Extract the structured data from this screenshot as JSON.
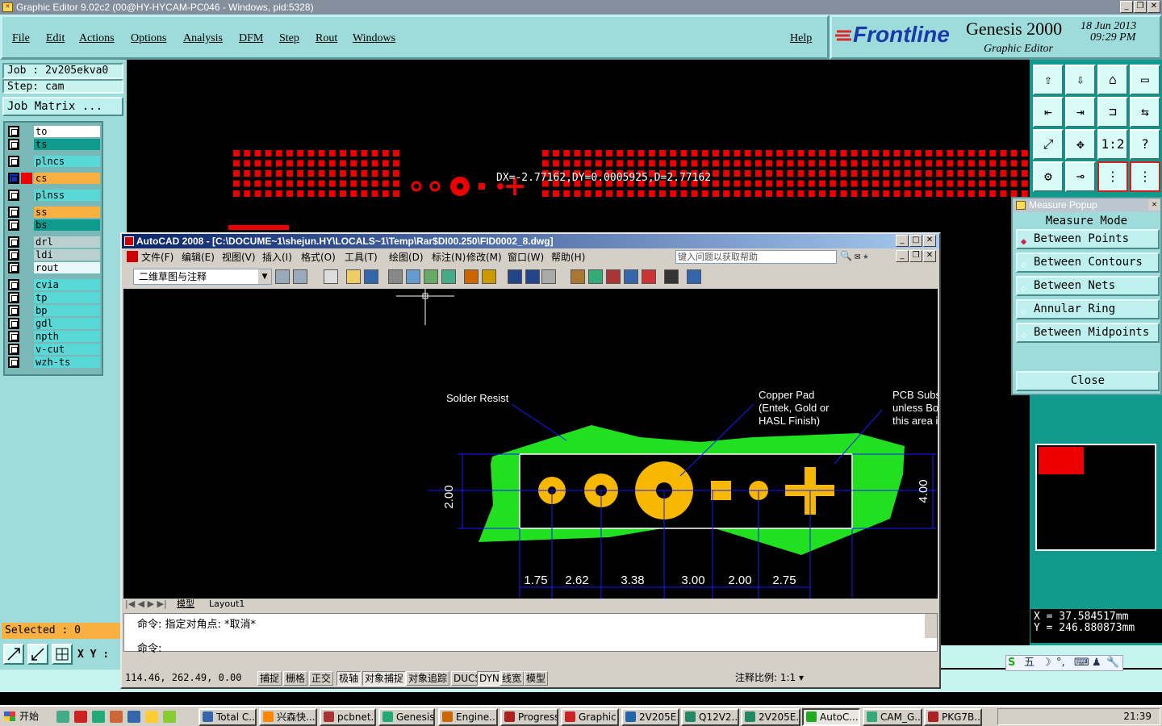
{
  "window": {
    "title": "Graphic Editor 9.02c2 (00@HY-HYCAM-PC046 - Windows, pid:5328)"
  },
  "menu": [
    "File",
    "Edit",
    "Actions",
    "Options",
    "Analysis",
    "DFM",
    "Step",
    "Rout",
    "Windows"
  ],
  "help": "Help",
  "brand": {
    "logo": "Frontline",
    "product": "Genesis 2000",
    "subtitle": "Graphic Editor",
    "date": "18 Jun 2013",
    "time": "09:29 PM"
  },
  "job": {
    "job_label": "Job : 2v205ekva0",
    "step_label": "Step: cam",
    "matrix_button": "Job Matrix ..."
  },
  "layers": [
    {
      "name": "to",
      "color": "#ffffff"
    },
    {
      "name": "ts",
      "color": "#0f9a8e"
    },
    {
      "name": "plncs",
      "color": "#59d8d8"
    },
    {
      "name": "cs",
      "color": "#f8b040",
      "active": true
    },
    {
      "name": "plnss",
      "color": "#59d8d8"
    },
    {
      "name": "ss",
      "color": "#f8b040"
    },
    {
      "name": "bs",
      "color": "#0f9a8e"
    },
    {
      "name": "drl",
      "color": "#b9d0d0"
    },
    {
      "name": "ldi",
      "color": "#b9d0d0"
    },
    {
      "name": "rout",
      "color": "#e8f8f8"
    },
    {
      "name": "cvia",
      "color": "#59d8d8"
    },
    {
      "name": "tp",
      "color": "#59d8d8"
    },
    {
      "name": "bp",
      "color": "#59d8d8"
    },
    {
      "name": "gdl",
      "color": "#59d8d8"
    },
    {
      "name": "npth",
      "color": "#59d8d8"
    },
    {
      "name": "v-cut",
      "color": "#59d8d8"
    },
    {
      "name": "wzh-ts",
      "color": "#59d8d8"
    }
  ],
  "selected": "Selected : 0",
  "xy_label": "X Y :",
  "measure_readout": "DX=-2.77162,DY=0.0005925,D=2.77162",
  "measure_popup": {
    "title": "Measure Popup",
    "mode_label": "Measure Mode",
    "options": [
      "Between Points",
      "Between Contours",
      "Between Nets",
      "Annular Ring",
      "Between Midpoints"
    ],
    "selected": "Between Points",
    "close": "Close"
  },
  "coords": {
    "x": "X  = 37.584517mm",
    "y": "Y  = 246.880873mm"
  },
  "autocad": {
    "title": "AutoCAD 2008 - [C:\\DOCUME~1\\shejun.HY\\LOCALS~1\\Temp\\Rar$DI00.250\\FID0002_8.dwg]",
    "menu": [
      "文件(F)",
      "编辑(E)",
      "视图(V)",
      "插入(I)",
      "格式(O)",
      "工具(T)",
      "绘图(D)",
      "标注(N)",
      "修改(M)",
      "窗口(W)",
      "帮助(H)"
    ],
    "help_placeholder": "键入问题以获取帮助",
    "workspace": "二维草图与注释",
    "tabs": [
      "模型",
      "Layout1"
    ],
    "annotations": {
      "solder_resist": "Solder Resist",
      "copper_pad": [
        "Copper Pad",
        "(Entek, Gold or",
        "HASL Finish)"
      ],
      "pcb_sub": [
        "PCB Subs",
        "unless Bo",
        "this area i"
      ]
    },
    "dimensions": {
      "h_left": "2.00",
      "h_right": "4.00",
      "bottom": [
        "1.75",
        "2.62",
        "3.38",
        "3.00",
        "2.00",
        "2.75"
      ]
    },
    "command_history": "命令: 指定对角点: *取消*",
    "command_prompt": "命令:",
    "coords": "114.46, 262.49, 0.00",
    "status_buttons": [
      "捕捉",
      "栅格",
      "正交",
      "极轴",
      "对象捕捉",
      "对象追踪",
      "DUCS",
      "DYN",
      "线宽",
      "模型"
    ],
    "annot_scale": "注释比例: 1:1 ▾"
  },
  "taskbar": {
    "start": "开始",
    "items": [
      "Total C...",
      "兴森快...",
      "pcbnet...",
      "Genesis",
      "Engine...",
      "Progress",
      "Graphic...",
      "2V205E...",
      "Q12V2...",
      "2V205E...",
      "AutoC...",
      "CAM_G...",
      "PKG7B..."
    ],
    "active": "AutoC...",
    "ime": "五",
    "clock": "21:39"
  }
}
